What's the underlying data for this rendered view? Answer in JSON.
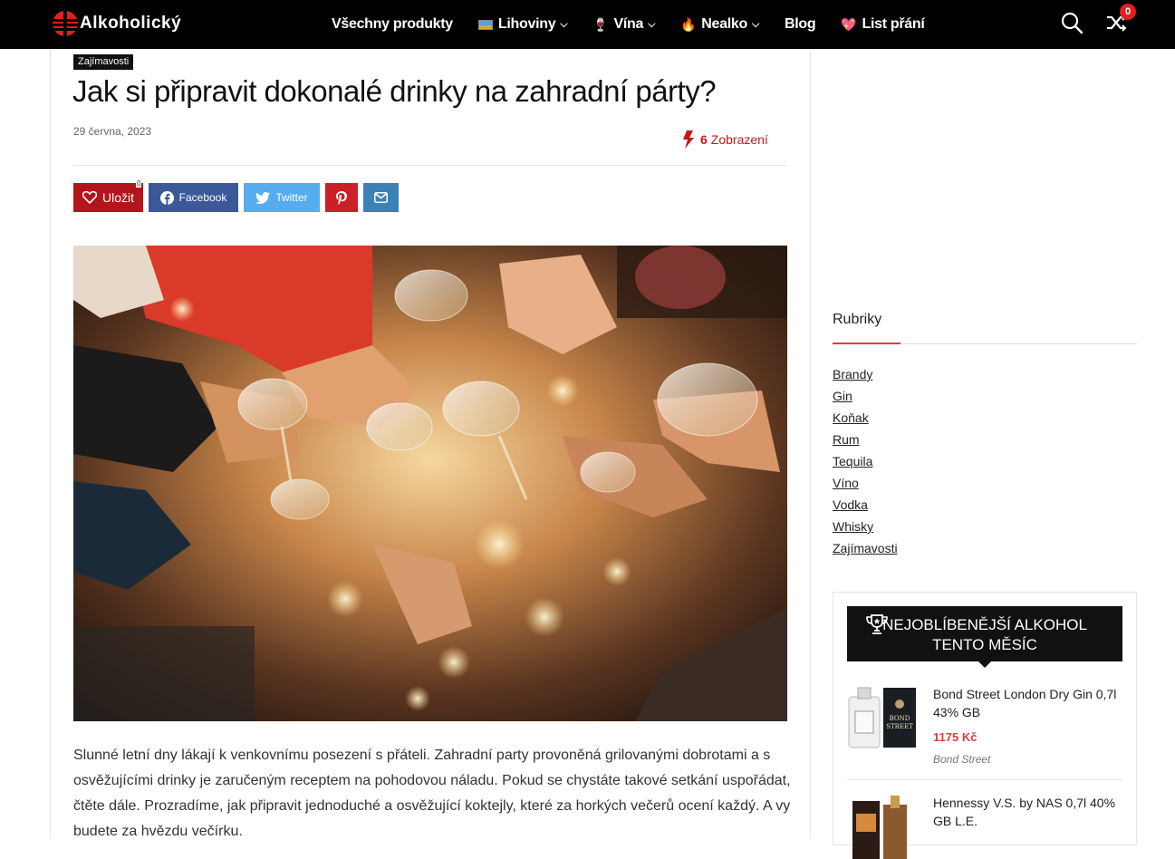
{
  "header": {
    "logo_text": "Alkoholický",
    "nav": [
      {
        "label": "Všechny produkty"
      },
      {
        "label": "Lihoviny"
      },
      {
        "label": "Vína"
      },
      {
        "label": "Nealko"
      },
      {
        "label": "Blog"
      },
      {
        "label": "List přání"
      }
    ],
    "compare_count": "0"
  },
  "article": {
    "category": "Zajímavosti",
    "title": "Jak si připravit dokonalé drinky na zahradní párty?",
    "date": "29 června, 2023",
    "views_count": "6",
    "views_label": "Zobrazení",
    "share": {
      "save_label": "Uložit",
      "save_count": "0",
      "facebook_label": "Facebook",
      "twitter_label": "Twitter"
    },
    "body": "Slunné letní dny lákají k venkovnímu posezení s přáteli. Zahradní party provoněná grilovanými dobrotami a s osvěžujícími drinky je zaručeným receptem na pohodovou náladu. Pokud se chystáte takové setkání uspořádat, čtěte dále. Prozradíme, jak připravit jednoduché a osvěžující koktejly, které za horkých večerů ocení každý. A vy budete za hvězdu večírku."
  },
  "sidebar": {
    "rubriky_title": "Rubriky",
    "rubriky": [
      "Brandy",
      "Gin",
      "Koňak",
      "Rum",
      "Tequila",
      "Víno",
      "Vodka",
      "Whisky",
      "Zajímavosti"
    ],
    "popular_title_line1": "NEJOBLÍBENĚJŠÍ ALKOHOL",
    "popular_title_line2": "TENTO MĚSÍC",
    "products": [
      {
        "name": "Bond Street London Dry Gin 0,7l 43% GB",
        "price": "1175 Kč",
        "brand": "Bond Street",
        "label_line1": "BOND",
        "label_line2": "STREET"
      },
      {
        "name": "Hennessy V.S. by NAS 0,7l 40% GB L.E."
      }
    ]
  },
  "colors": {
    "accent_red": "#e43b3b",
    "facebook": "#3b5998",
    "twitter": "#55acee",
    "pinterest": "#cb2027",
    "email": "#3b81b7"
  }
}
